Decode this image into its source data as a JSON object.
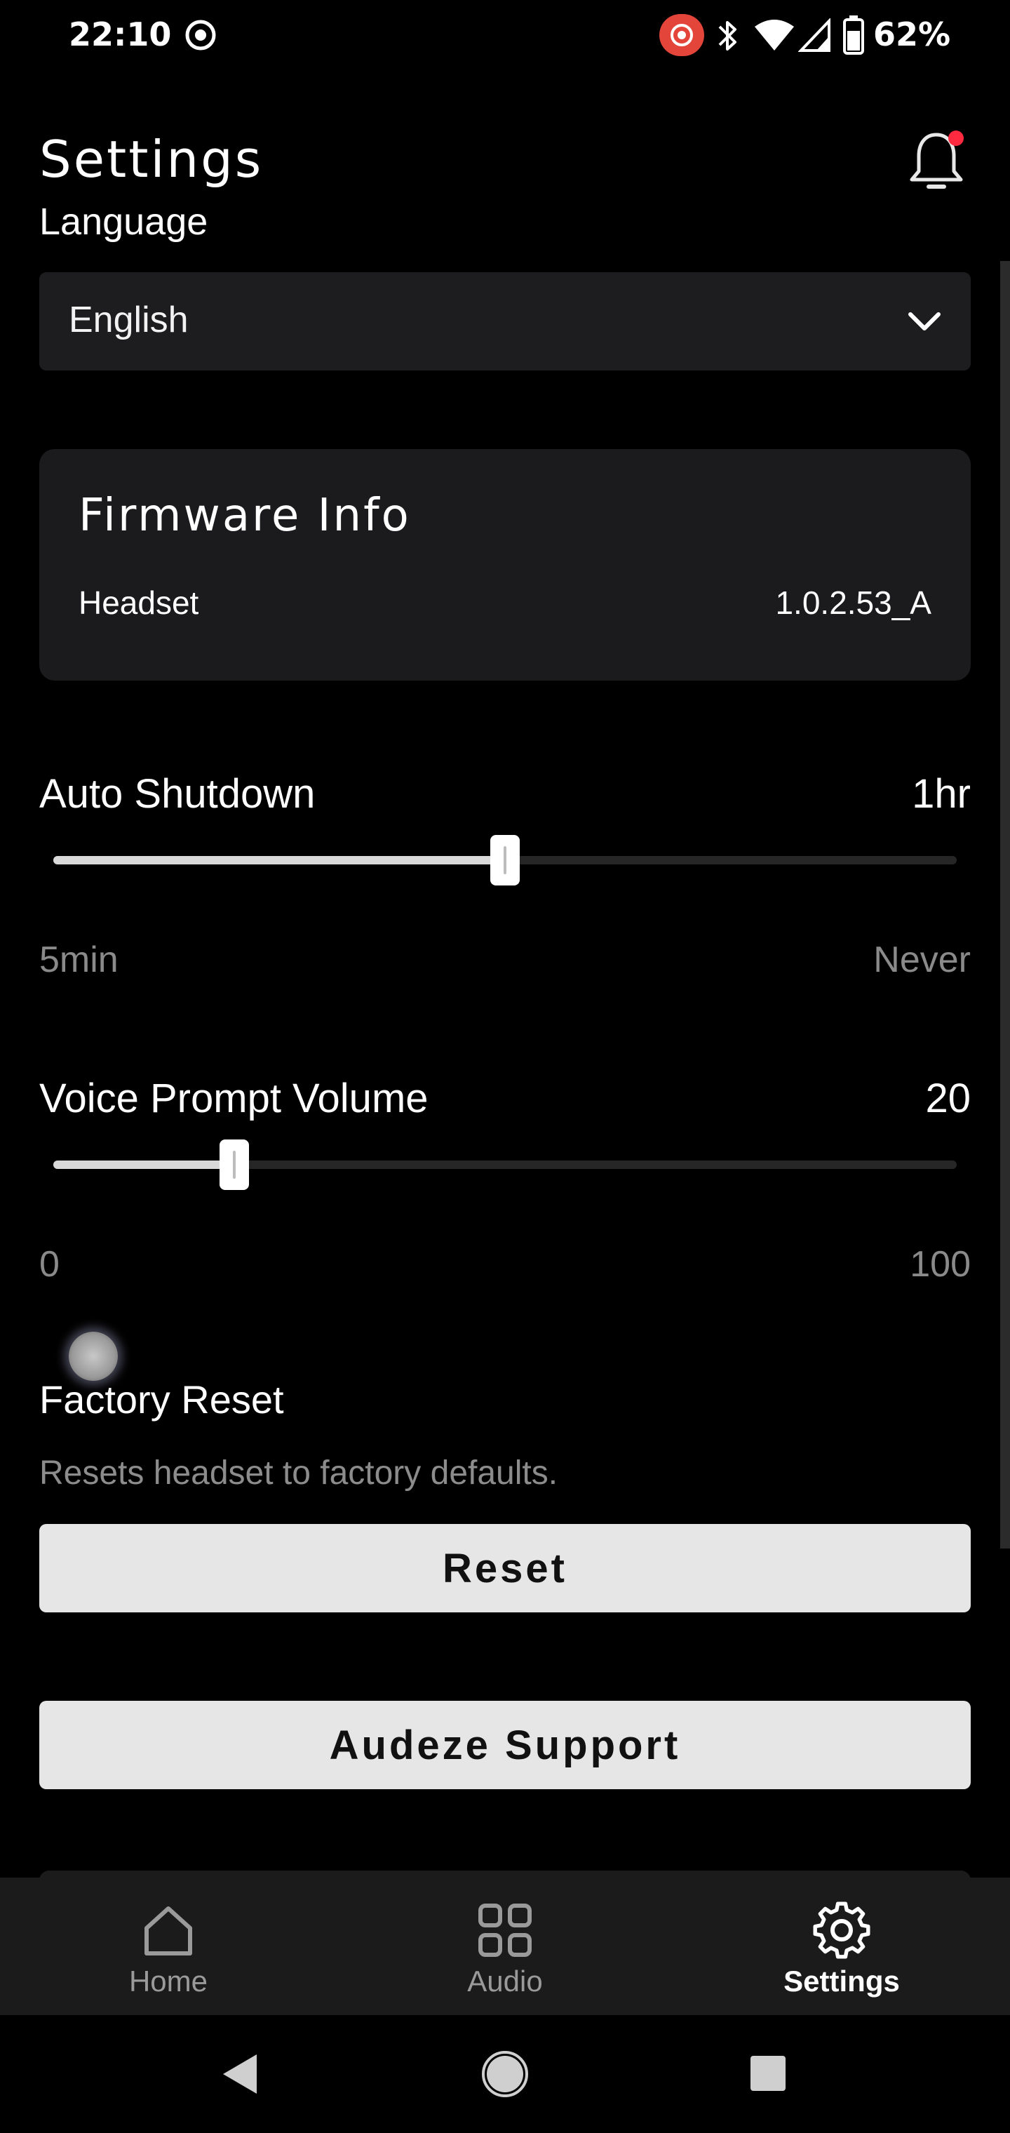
{
  "status_bar": {
    "time": "22:10",
    "battery_percent": "62%",
    "icons": [
      "screen-record-icon",
      "cast-record-icon",
      "bluetooth-icon",
      "wifi-icon",
      "cell-signal-icon",
      "battery-icon"
    ]
  },
  "header": {
    "title": "Settings",
    "notification_dot_color": "#ff2a40"
  },
  "language": {
    "label": "Language",
    "selected": "English"
  },
  "firmware": {
    "title": "Firmware Info",
    "rows": [
      {
        "label": "Headset",
        "value": "1.0.2.53_A"
      }
    ]
  },
  "auto_shutdown": {
    "title": "Auto Shutdown",
    "value": "1hr",
    "min_label": "5min",
    "max_label": "Never",
    "position_fraction": 0.5
  },
  "voice_prompt_volume": {
    "title": "Voice Prompt Volume",
    "value": "20",
    "min_label": "0",
    "max_label": "100",
    "position_fraction": 0.2
  },
  "factory_reset": {
    "title": "Factory Reset",
    "description": "Resets headset to factory defaults.",
    "button_label": "Reset"
  },
  "support": {
    "button_label": "Audeze Support"
  },
  "bottom_nav": {
    "items": [
      {
        "label": "Home",
        "icon": "home-icon",
        "active": false
      },
      {
        "label": "Audio",
        "icon": "grid-icon",
        "active": false
      },
      {
        "label": "Settings",
        "icon": "gear-icon",
        "active": true
      }
    ]
  },
  "colors": {
    "background": "#000000",
    "card": "#1b1b1d",
    "button": "#e6e6e6",
    "muted_text": "#8a8a8a",
    "accent_record": "#e4453a"
  }
}
